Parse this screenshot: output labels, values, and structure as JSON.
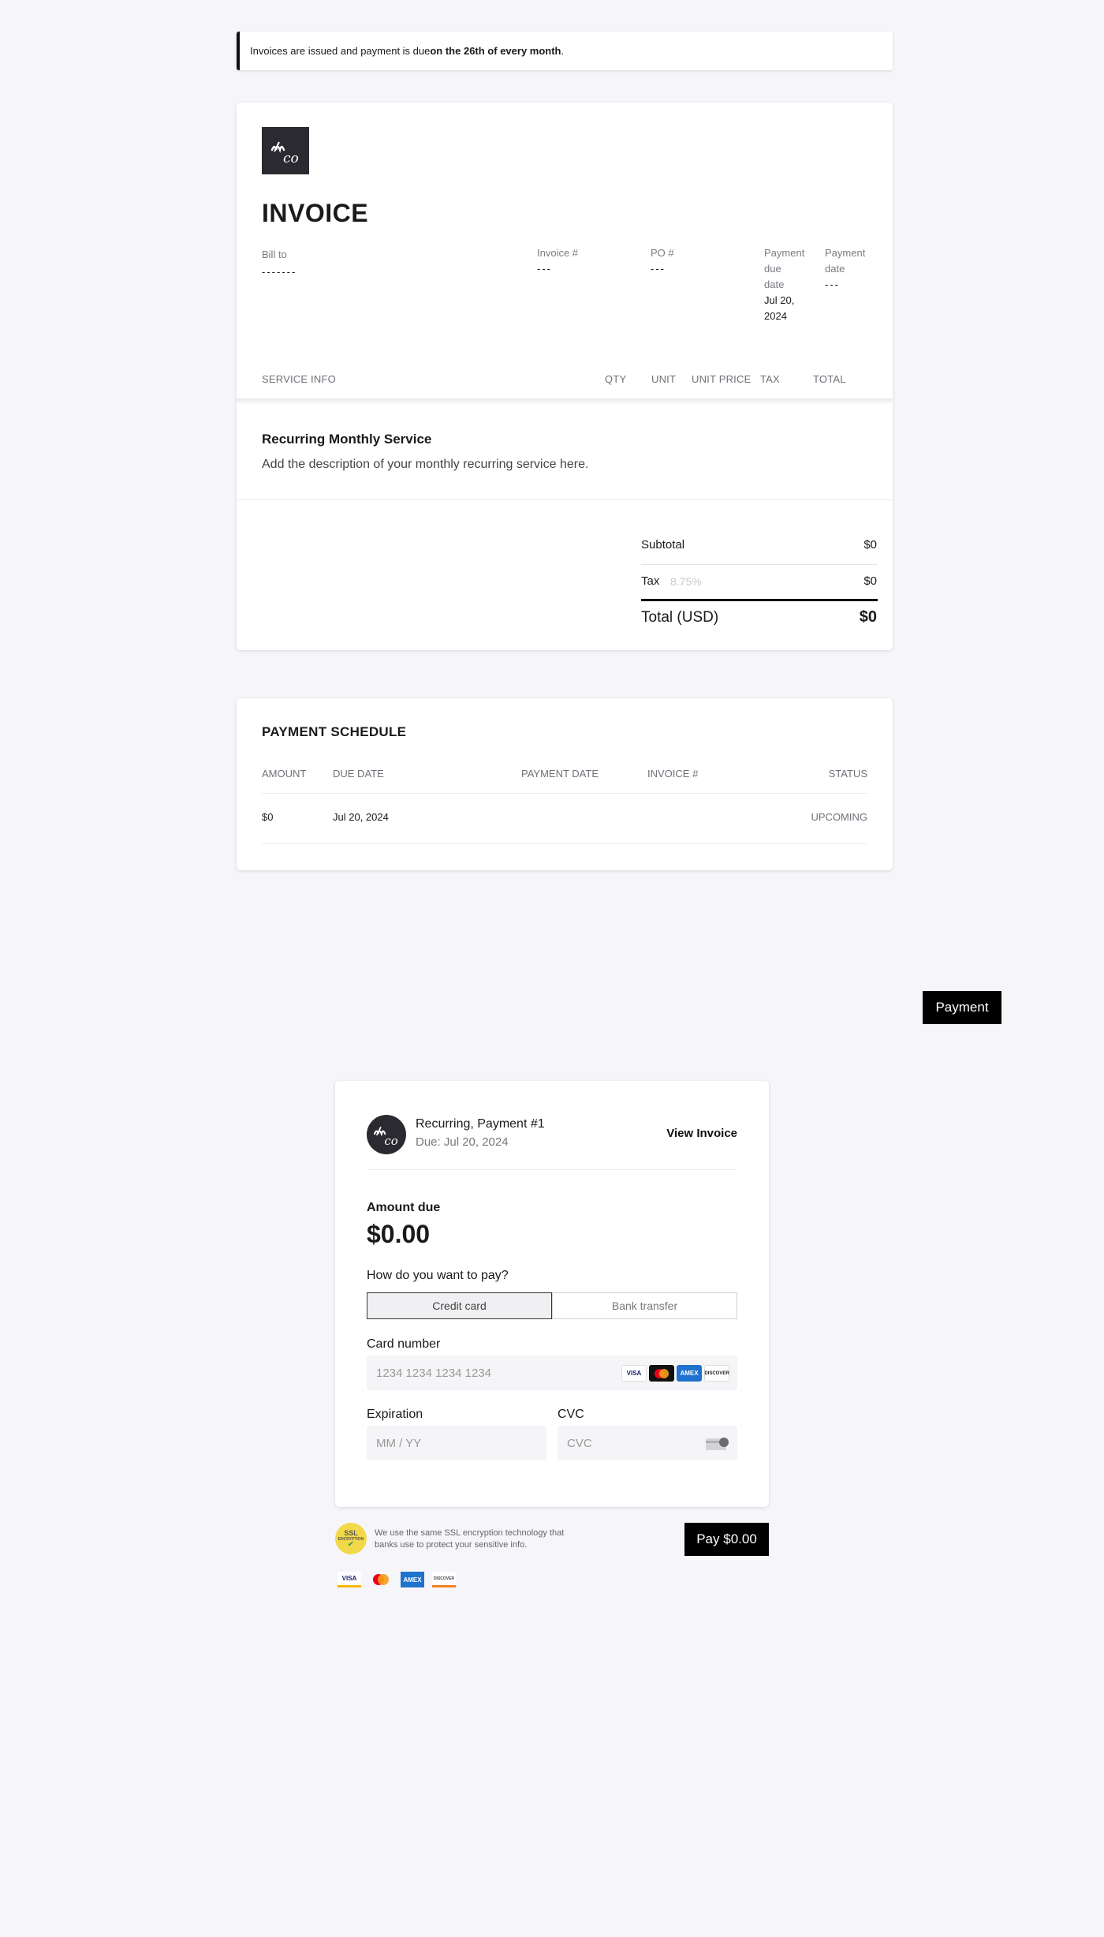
{
  "notice": {
    "text_prefix": "Invoices are issued and payment is due ",
    "text_bold": "on the 26th of every month",
    "text_suffix": "."
  },
  "invoice": {
    "logo_text": "mco",
    "title": "INVOICE",
    "bill_to_label": "Bill to",
    "bill_to_value": "-------",
    "invoice_no_label": "Invoice #",
    "invoice_no_value": "---",
    "po_label": "PO #",
    "po_value": "---",
    "payment_due_label_1": "Payment",
    "payment_due_label_2": "due",
    "payment_due_label_3": "date",
    "payment_due_value_1": "Jul 20,",
    "payment_due_value_2": "2024",
    "payment_date_label_1": "Payment",
    "payment_date_label_2": "date",
    "payment_date_value": "---",
    "columns": [
      "SERVICE INFO",
      "QTY",
      "UNIT",
      "UNIT PRICE",
      "TAX",
      "TOTAL"
    ],
    "service_title": "Recurring Monthly Service",
    "service_desc": "Add the description of your monthly recurring service here.",
    "subtotal_label": "Subtotal",
    "subtotal_value": "$0",
    "tax_label": "Tax",
    "tax_rate": "8.75%",
    "tax_value": "$0",
    "total_label": "Total (USD)",
    "total_value": "$0"
  },
  "schedule": {
    "title": "PAYMENT SCHEDULE",
    "headers": [
      "AMOUNT",
      "DUE DATE",
      "PAYMENT DATE",
      "INVOICE #",
      "STATUS"
    ],
    "row": {
      "amount": "$0",
      "due_date": "Jul 20, 2024",
      "payment_date": "",
      "invoice_no": "",
      "status": "UPCOMING"
    }
  },
  "payment_button": "Payment",
  "pay_card": {
    "title": "Recurring, Payment #1",
    "due": "Due: Jul 20, 2024",
    "view_invoice": "View Invoice",
    "amount_label": "Amount due",
    "amount": "$0.00",
    "how_label": "How do you want to pay?",
    "tabs": [
      "Credit card",
      "Bank transfer"
    ],
    "card_number_label": "Card number",
    "card_number_placeholder": "1234 1234 1234 1234",
    "expiration_label": "Expiration",
    "expiration_placeholder": "MM / YY",
    "cvc_label": "CVC",
    "cvc_placeholder": "CVC",
    "card_brands": [
      "VISA",
      "mastercard-icon",
      "AMEX",
      "DISCOVER"
    ]
  },
  "footer": {
    "ssl_badge": "SSL",
    "ssl_badge_sub": "ENCRYPTION",
    "ssl_text": "We use the same SSL encryption technology that banks use to protect your sensitive info.",
    "pay_button": "Pay $0.00",
    "brands": [
      "VISA",
      "mastercard-icon",
      "AMEX",
      "DISCOVER"
    ]
  },
  "colors": {
    "accent": "#000000",
    "logo_bg": "#2a2a30",
    "page_bg": "#f6f6fa",
    "amex": "#1f72cd",
    "ssl": "#f3d84a"
  }
}
